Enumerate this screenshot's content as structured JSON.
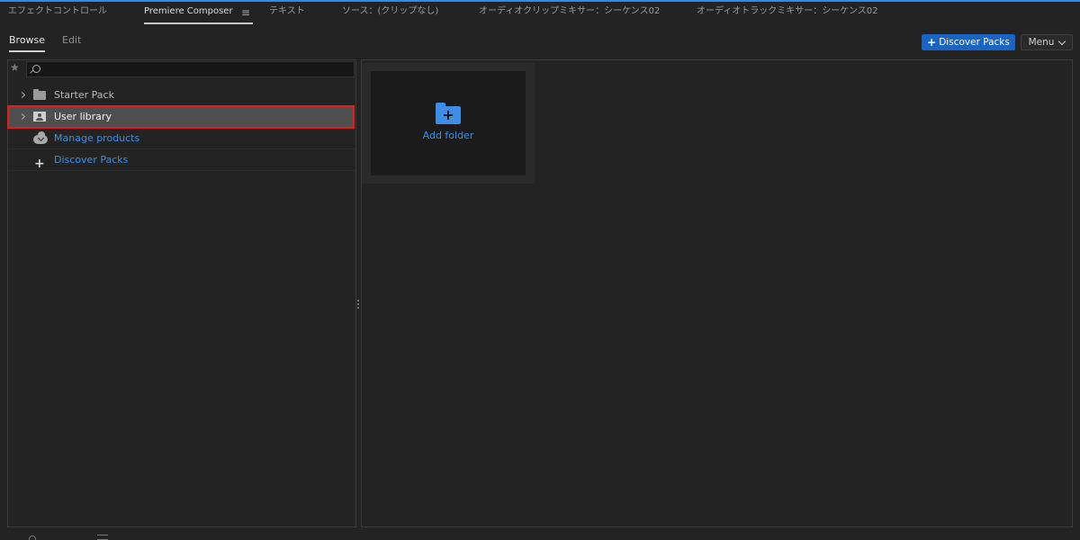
{
  "panel_tabs": [
    {
      "label": "エフェクトコントロール",
      "active": false
    },
    {
      "label": "Premiere Composer",
      "active": true
    },
    {
      "label": "テキスト",
      "active": false
    },
    {
      "label": "ソース：(クリップなし)",
      "active": false
    },
    {
      "label": "オーディオクリップミキサー：シーケンス02",
      "active": false
    },
    {
      "label": "オーディオトラックミキサー：シーケンス02",
      "active": false
    }
  ],
  "tab_menu_glyph": "≡",
  "sub_tabs": [
    {
      "label": "Browse",
      "active": true
    },
    {
      "label": "Edit",
      "active": false
    }
  ],
  "header": {
    "discover_plus": "+",
    "discover_label": "Discover Packs",
    "menu_label": "Menu"
  },
  "search": {
    "placeholder": "",
    "value": "",
    "star_glyph": "★"
  },
  "tree": [
    {
      "label": "Starter Pack",
      "icon": "folder-icon",
      "expandable": true,
      "selected": false,
      "link": false
    },
    {
      "label": "User library",
      "icon": "user-library-icon",
      "expandable": true,
      "selected": true,
      "link": false
    },
    {
      "label": "Manage products",
      "icon": "cloud-download-icon",
      "expandable": false,
      "selected": false,
      "link": true
    },
    {
      "label": "Discover Packs",
      "icon": "plus-icon",
      "expandable": false,
      "selected": false,
      "link": true
    }
  ],
  "content": {
    "add_folder_label": "Add folder",
    "add_folder_plus": "+"
  },
  "colors": {
    "accent_blue": "#1a64c4",
    "link_blue": "#3b8fe6",
    "selection_outline": "#e81b1b",
    "background": "#232323"
  }
}
